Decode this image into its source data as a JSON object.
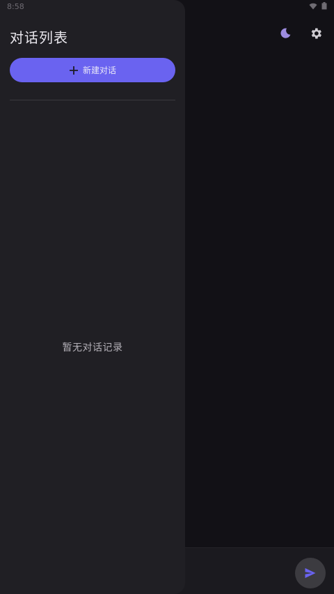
{
  "status_bar": {
    "time": "8:58"
  },
  "drawer": {
    "title": "对话列表",
    "new_chat_label": "新建对话",
    "empty_text": "暂无对话记录"
  },
  "header": {
    "theme_icon": "moon-icon",
    "settings_icon": "gear-icon"
  },
  "composer": {
    "send_icon": "send-icon"
  },
  "colors": {
    "accent": "#6a63f0",
    "drawer_bg": "#201f24",
    "main_bg": "#121116",
    "icon_tint": "#9e8de0"
  }
}
